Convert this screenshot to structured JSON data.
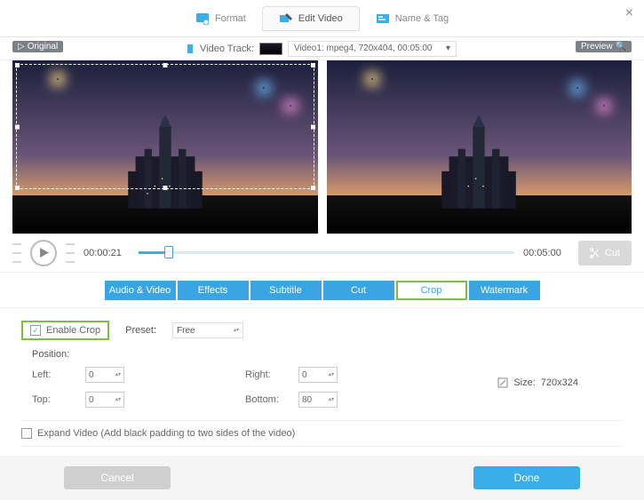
{
  "topbar": {
    "tabs": {
      "format": "Format",
      "edit": "Edit Video",
      "name_tag": "Name & Tag"
    }
  },
  "track": {
    "label": "Video Track:",
    "selected": "Video1: mpeg4, 720x404, 00:05:00",
    "original_badge": "Original",
    "preview_badge": "Preview"
  },
  "playback": {
    "current": "00:00:21",
    "total": "00:05:00",
    "cut_label": "Cut"
  },
  "subtabs": {
    "audio_video": "Audio & Video",
    "effects": "Effects",
    "subtitle": "Subtitle",
    "cut": "Cut",
    "crop": "Crop",
    "watermark": "Watermark"
  },
  "crop": {
    "enable": "Enable Crop",
    "preset_label": "Preset:",
    "preset_value": "Free",
    "position_label": "Position:",
    "left_label": "Left:",
    "left_value": "0",
    "right_label": "Right:",
    "right_value": "0",
    "top_label": "Top:",
    "top_value": "0",
    "bottom_label": "Bottom:",
    "bottom_value": "80",
    "size_label": "Size:",
    "size_value": "720x324",
    "expand": "Expand Video (Add black padding to two sides of the video)"
  },
  "footer": {
    "cancel": "Cancel",
    "done": "Done"
  },
  "colors": {
    "accent": "#39aee9",
    "highlight": "#7bc043"
  }
}
